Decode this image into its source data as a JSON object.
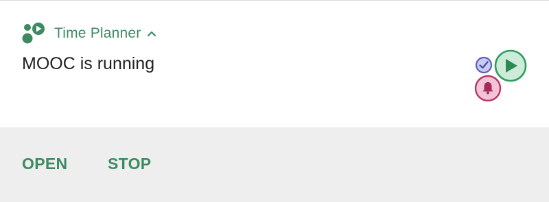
{
  "notification": {
    "app_name": "Time Planner",
    "message": "MOOC is running",
    "expand_icon": "chevron-up-icon",
    "app_icon": "time-planner-app-icon",
    "large_icon": [
      "check-icon",
      "play-icon",
      "bell-icon"
    ]
  },
  "actions": {
    "open_label": "OPEN",
    "stop_label": "STOP"
  },
  "colors": {
    "accent": "#3d8a62",
    "action_bar": "#eeeeee",
    "check": "#5c5fb8",
    "play": "#2e9e5e",
    "bell": "#b8336a"
  }
}
